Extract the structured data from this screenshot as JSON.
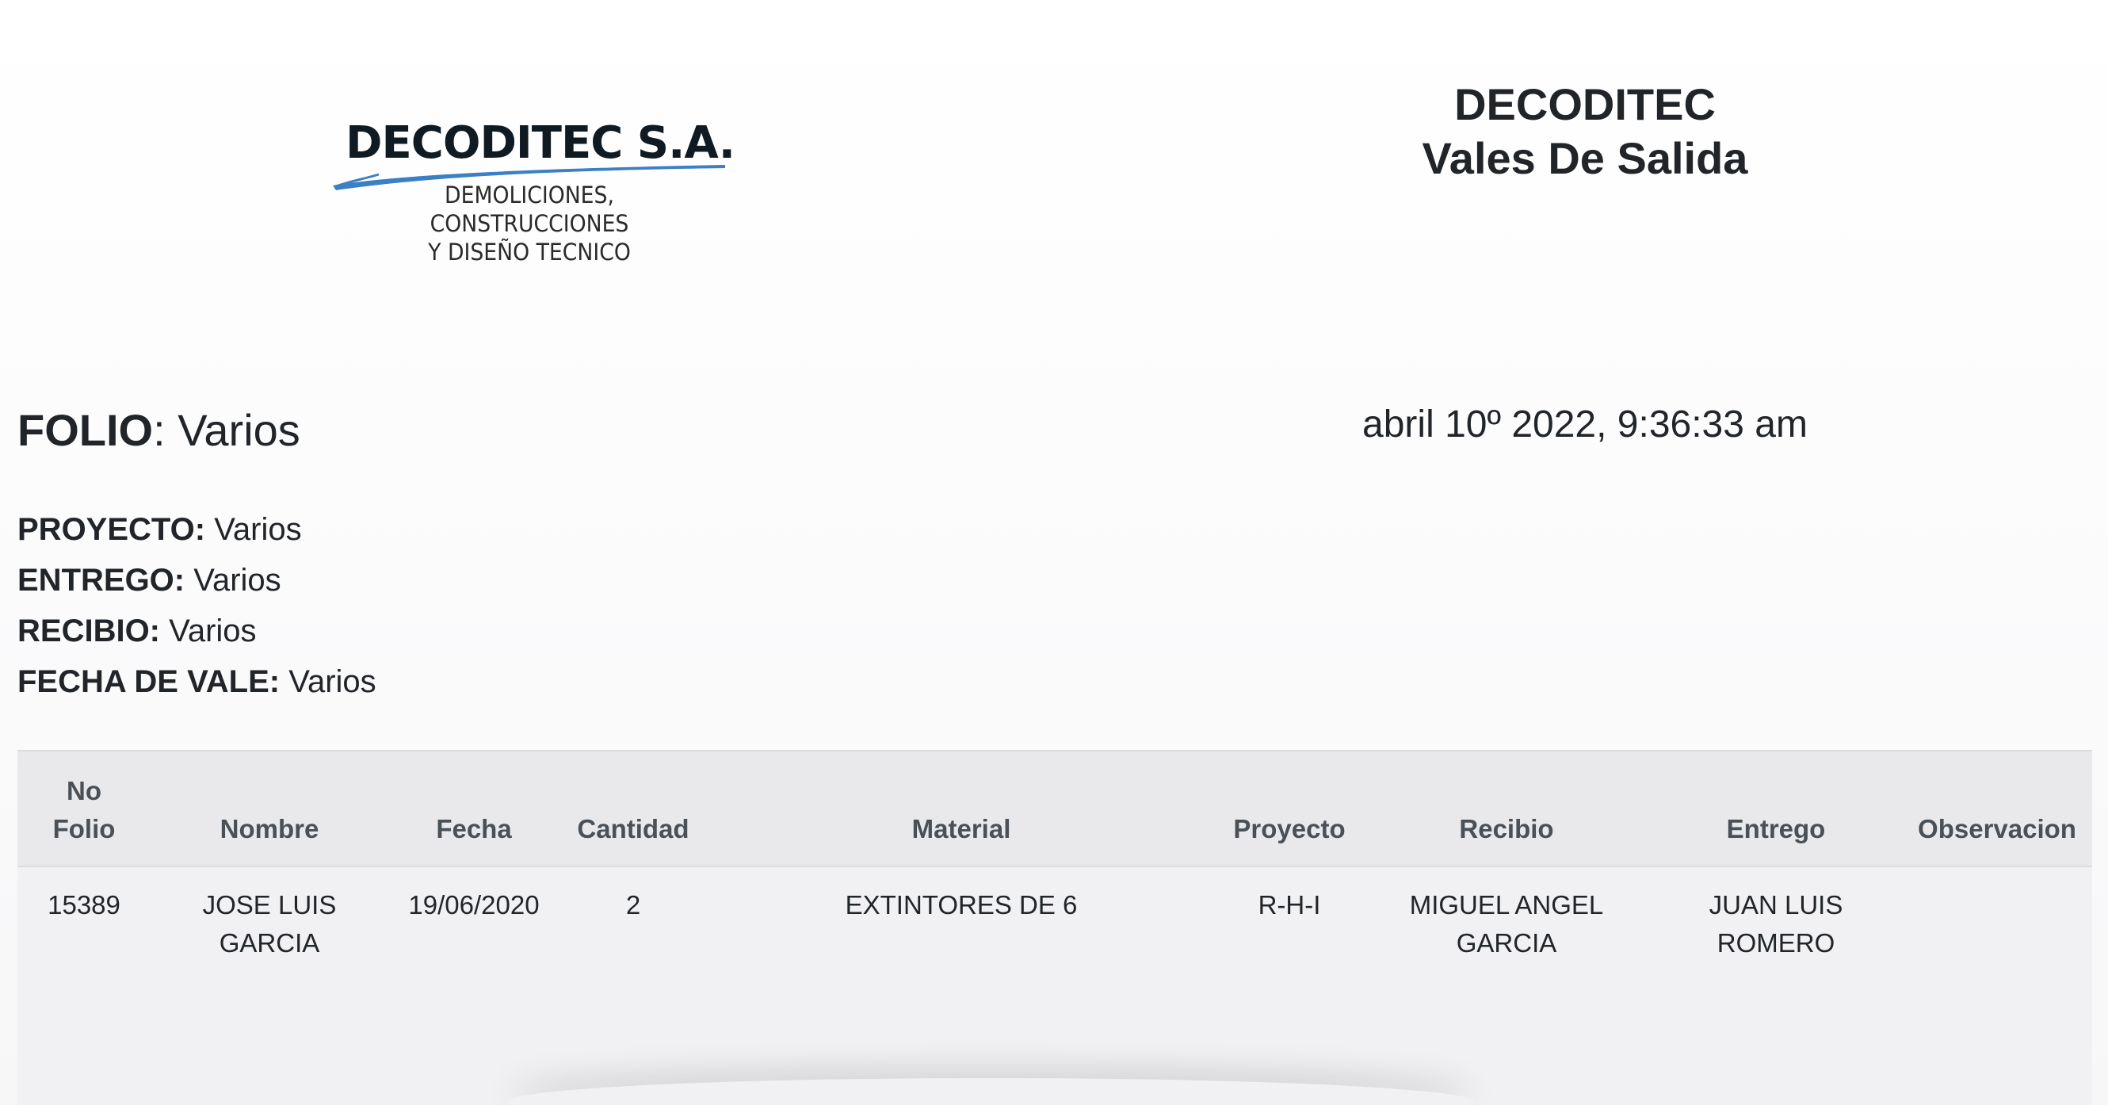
{
  "logo": {
    "title": "DECODITEC S.A.",
    "subtitle_line1": "DEMOLICIONES, CONSTRUCCIONES",
    "subtitle_line2": "Y DISEÑO TECNICO",
    "swoosh_color": "#3b7fc4"
  },
  "heading": {
    "line1": "DECODITEC",
    "line2": "Vales De Salida"
  },
  "folio": {
    "label": "FOLIO",
    "value": ": Varios"
  },
  "timestamp": "abril 10º 2022, 9:36:33 am",
  "meta": [
    {
      "label": "PROYECTO:",
      "value": " Varios"
    },
    {
      "label": "ENTREGO:",
      "value": " Varios"
    },
    {
      "label": "RECIBIO:",
      "value": " Varios"
    },
    {
      "label": "FECHA DE VALE:",
      "value": " Varios"
    }
  ],
  "table": {
    "headers": {
      "no_folio_1": "No",
      "no_folio_2": "Folio",
      "nombre": "Nombre",
      "fecha": "Fecha",
      "cantidad": "Cantidad",
      "material": "Material",
      "proyecto": "Proyecto",
      "recibio": "Recibio",
      "entrego": "Entrego",
      "observacion": "Observacion"
    },
    "rows": [
      {
        "no_folio": "15389",
        "nombre_1": "JOSE LUIS",
        "nombre_2": "GARCIA",
        "fecha": "19/06/2020",
        "cantidad": "2",
        "material": "EXTINTORES DE 6",
        "proyecto": "R-H-I",
        "recibio_1": "MIGUEL ANGEL",
        "recibio_2": "GARCIA",
        "entrego_1": "JUAN LUIS",
        "entrego_2": "ROMERO",
        "observacion": ""
      }
    ]
  }
}
